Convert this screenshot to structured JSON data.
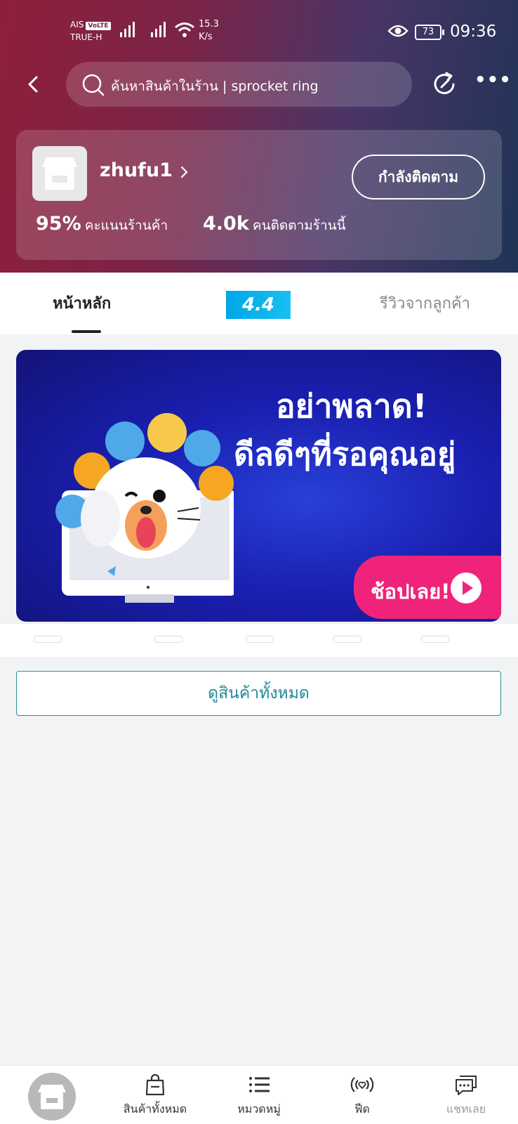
{
  "status_bar": {
    "carrier_top": "AIS",
    "volte": "VoLTE",
    "carrier_bottom": "TRUE-H",
    "net_speed_value": "15.3",
    "net_speed_unit": "K/s",
    "battery": "73",
    "time": "09:36"
  },
  "header": {
    "search_text": "ค้นหาสินค้าในร้าน | sprocket ring"
  },
  "shop": {
    "name": "zhufu1",
    "follow_label": "กำลังติดตาม",
    "rating_value": "95%",
    "rating_label": "คะแนนร้านค้า",
    "followers_value": "4.0k",
    "followers_label": "คนติดตามร้านนี้"
  },
  "tabs": {
    "home": "หน้าหลัก",
    "promo": "4.4",
    "reviews": "รีวิวจากลูกค้า"
  },
  "banner": {
    "line1": "อย่าพลาด!",
    "line2": "ดีลดีๆที่รอคุณอยู่",
    "cta": "ช้อปเลย!"
  },
  "view_all_label": "ดูสินค้าทั้งหมด",
  "bottom_nav": {
    "all_products": "สินค้าทั้งหมด",
    "categories": "หมวดหมู่",
    "feed": "ฟีด",
    "chat": "แชทเลย"
  },
  "colors": {
    "accent_teal": "#1e8a9c",
    "cta_pink": "#f0237a",
    "promo_blue": "#00a6e8",
    "banner_blue": "#1a1fb0"
  }
}
